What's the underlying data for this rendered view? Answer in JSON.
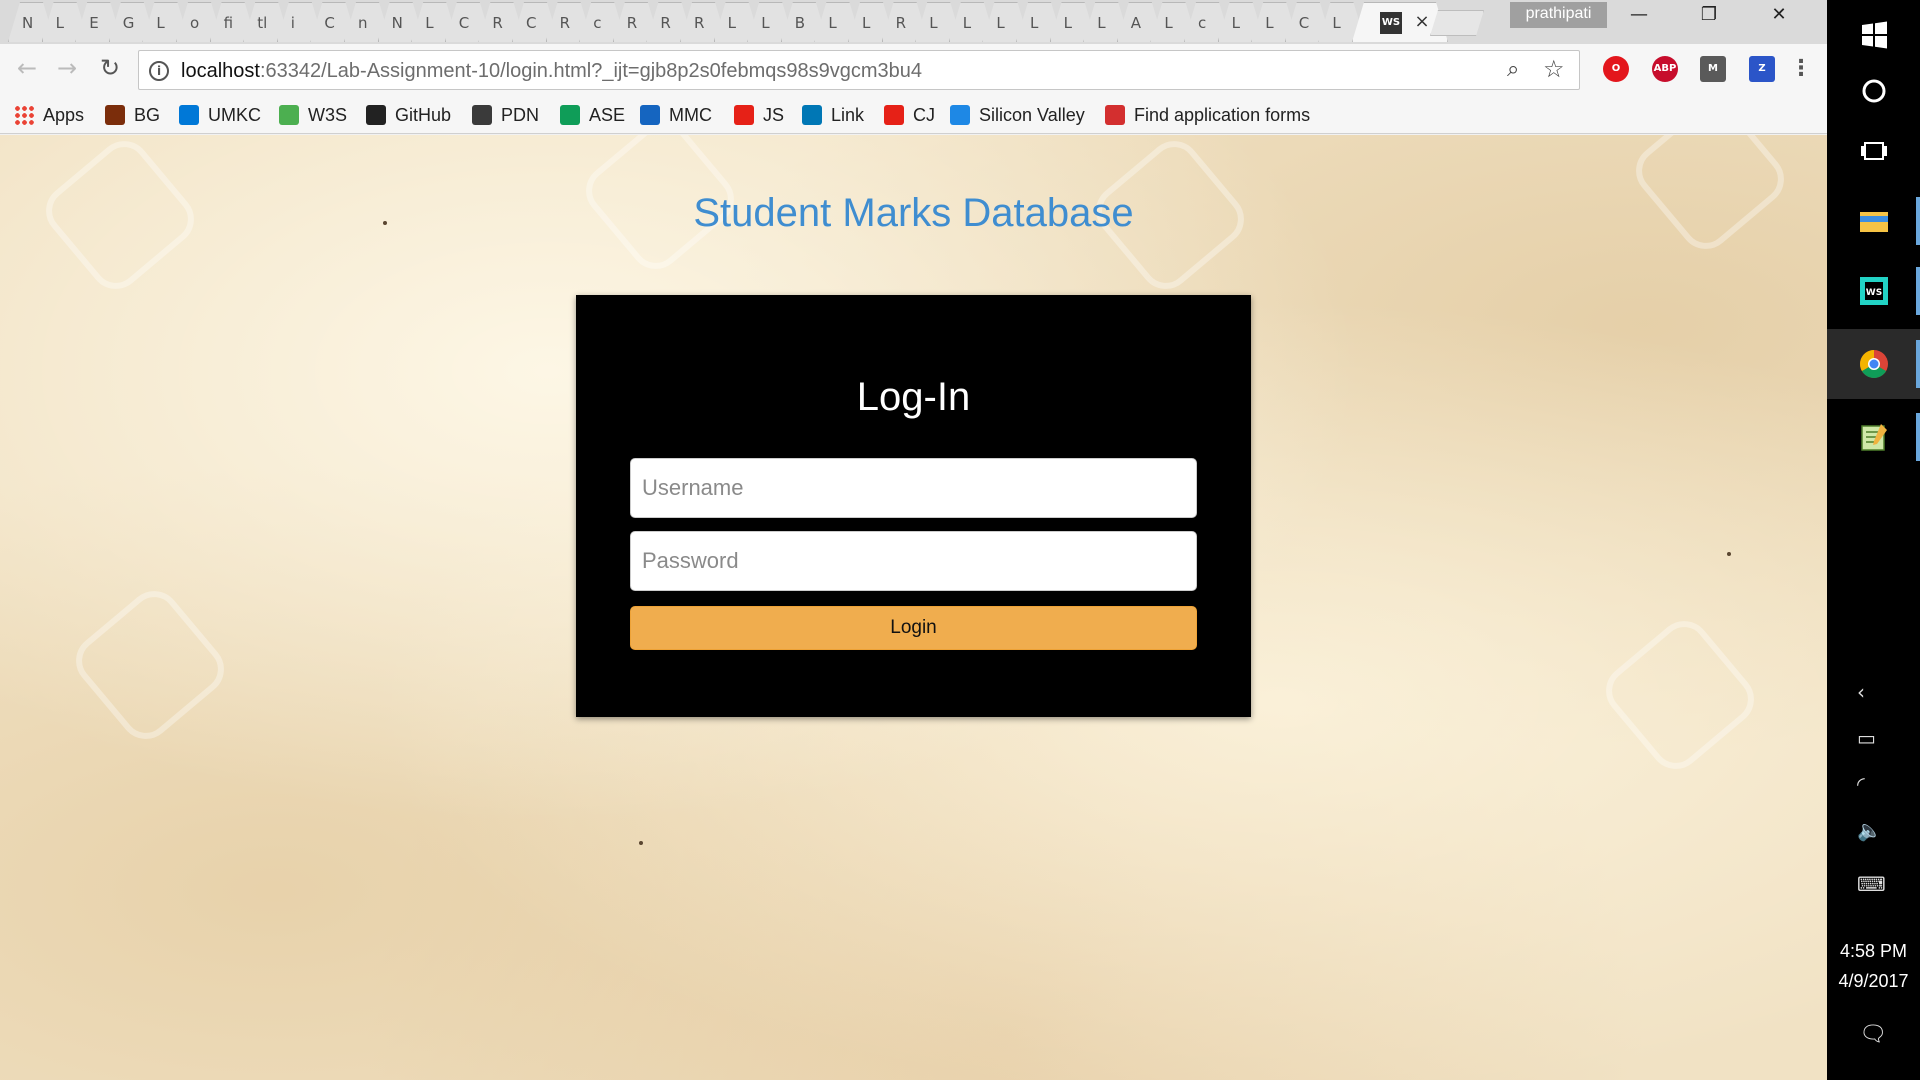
{
  "browser": {
    "tabs": [
      "N",
      "L",
      "E",
      "G",
      "L",
      "o",
      "fi",
      "tl",
      "i",
      "C",
      "n",
      "N",
      "L",
      "C",
      "R",
      "C",
      "R",
      "c",
      "R",
      "R",
      "R",
      "L",
      "L",
      "B",
      "L",
      "L",
      "R",
      "L",
      "L",
      "L",
      "L",
      "L",
      "L",
      "A",
      "L",
      "c",
      "L",
      "L",
      "C",
      "L"
    ],
    "active_tab_icon": "WS",
    "active_tab_close": "×",
    "profile_name": "prathipati",
    "window_buttons": {
      "minimize": "—",
      "restore": "❐",
      "close": "✕"
    },
    "nav": {
      "back": "←",
      "forward": "→",
      "reload": "↻"
    },
    "address": {
      "host": "localhost",
      "path": ":63342/Lab-Assignment-10/login.html?_ijt=gjb8p2s0febmqs98s9vgcm3bu4",
      "info_icon": "i"
    },
    "zoom_icon": "⌕",
    "star_icon": "☆",
    "extensions": [
      {
        "name": "opera-extension",
        "label": "O",
        "color": "#e3161c"
      },
      {
        "name": "adblock-plus",
        "label": "ABP",
        "color": "#c70d2c"
      },
      {
        "name": "extension-m",
        "label": "M",
        "color": "#5a5a5a"
      },
      {
        "name": "extension-z",
        "label": "Z",
        "color": "#2b55c8"
      }
    ],
    "menu_icon": "⋮",
    "bookmarks": [
      {
        "label": "Apps",
        "color": "#ea4335"
      },
      {
        "label": "BG",
        "color": "#7b2d0b"
      },
      {
        "label": "UMKC",
        "color": "#0078d7"
      },
      {
        "label": "W3S",
        "color": "#4caf50"
      },
      {
        "label": "GitHub",
        "color": "#222222"
      },
      {
        "label": "PDN",
        "color": "#3a3a3a"
      },
      {
        "label": "ASE",
        "color": "#0f9d58"
      },
      {
        "label": "MMC",
        "color": "#1565c0"
      },
      {
        "label": "JS",
        "color": "#e62117"
      },
      {
        "label": "Link",
        "color": "#0077b5"
      },
      {
        "label": "CJ",
        "color": "#e62117"
      },
      {
        "label": "Silicon Valley",
        "color": "#1e88e5"
      },
      {
        "label": "Find application forms",
        "color": "#d32f2f"
      }
    ]
  },
  "page": {
    "title": "Student Marks Database",
    "login": {
      "heading": "Log-In",
      "username_placeholder": "Username",
      "password_placeholder": "Password",
      "button_label": "Login"
    }
  },
  "taskbar": {
    "time": "4:58 PM",
    "date": "4/9/2017",
    "tray_icons": [
      "chevron-left-icon",
      "battery-icon",
      "wifi-icon",
      "volume-muted-icon",
      "keyboard-icon"
    ],
    "tray_glyphs": [
      "‹",
      "▭",
      "◜",
      "🔈",
      "⌨"
    ],
    "notification_glyph": "🗨"
  }
}
